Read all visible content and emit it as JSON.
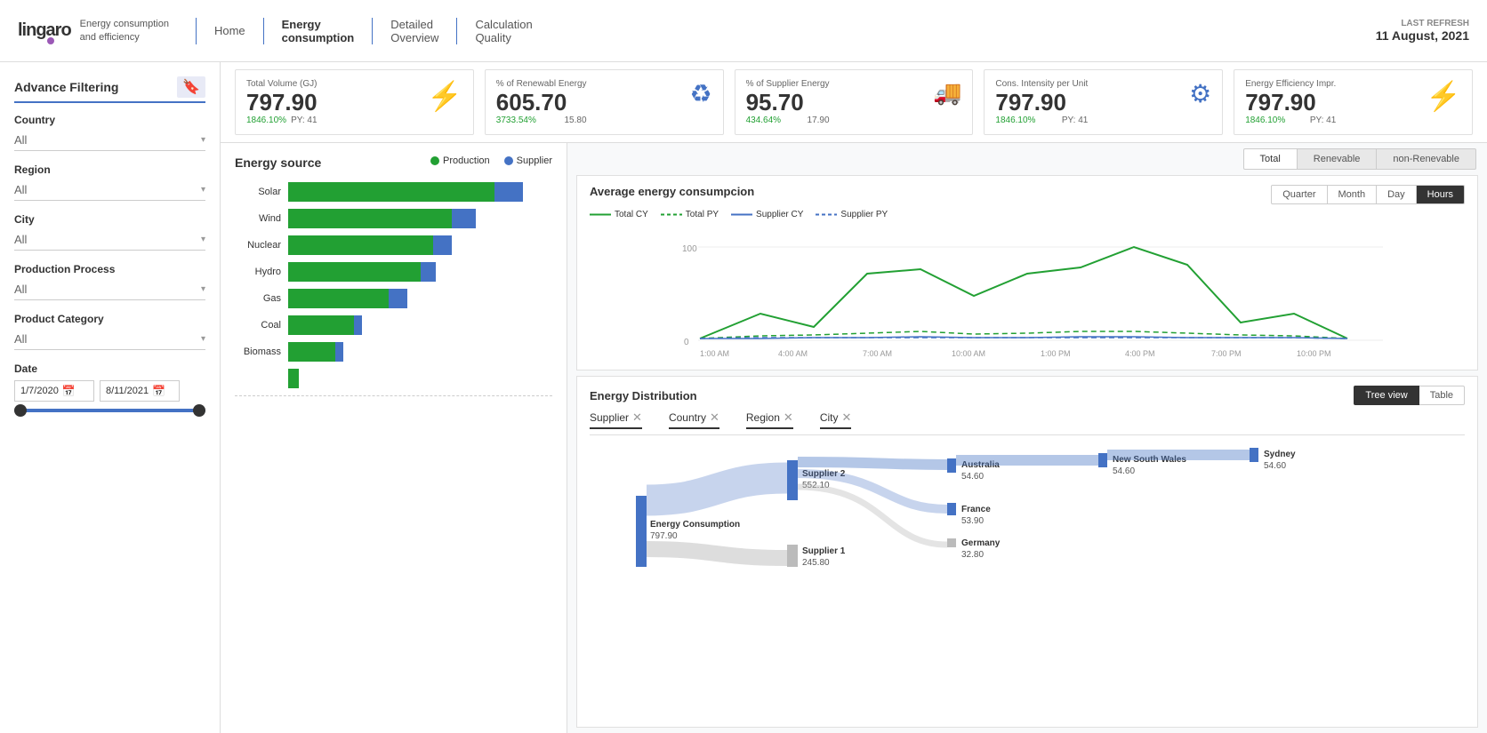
{
  "header": {
    "logo_text": "lingaro",
    "logo_subtitle": "Energy consumption\nand efficiency",
    "nav_items": [
      {
        "label": "Home",
        "active": false
      },
      {
        "label": "Energy\nconsumption",
        "active": true
      },
      {
        "label": "Detailed\nOverview",
        "active": false
      },
      {
        "label": "Calculation\nQuality",
        "active": false
      }
    ],
    "last_refresh_label": "LAST REFRESH",
    "last_refresh_date": "11 August, 2021"
  },
  "kpi_cards": [
    {
      "label": "Total Volume (GJ)",
      "value": "797.90",
      "percent": "1846.10%",
      "py": "PY: 41",
      "icon": "⚡"
    },
    {
      "label": "% of Renewabl Energy",
      "value": "605.70",
      "percent": "3733.54%",
      "py": "15.80",
      "icon": "♻"
    },
    {
      "label": "% of Supplier Energy",
      "value": "95.70",
      "percent": "434.64%",
      "py": "17.90",
      "icon": "🚚"
    },
    {
      "label": "Cons. Intensity per Unit",
      "value": "797.90",
      "percent": "1846.10%",
      "py": "PY: 41",
      "icon": "⚙"
    },
    {
      "label": "Energy Efficiency Impr.",
      "value": "797.90",
      "percent": "1846.10%",
      "py": "PY: 41",
      "icon": "⚡"
    }
  ],
  "sidebar": {
    "title": "Advance Filtering",
    "filters": [
      {
        "label": "Country",
        "value": "All"
      },
      {
        "label": "Region",
        "value": "All"
      },
      {
        "label": "City",
        "value": "All"
      },
      {
        "label": "Production Process",
        "value": "All"
      },
      {
        "label": "Product Category",
        "value": "All"
      }
    ],
    "date": {
      "label": "Date",
      "from": "1/7/2020",
      "to": "8/11/2021"
    }
  },
  "energy_source": {
    "title": "Energy source",
    "legend_production": "Production",
    "legend_supplier": "Supplier",
    "bars": [
      {
        "label": "Solar",
        "green": 85,
        "blue": 12
      },
      {
        "label": "Wind",
        "green": 68,
        "blue": 10
      },
      {
        "label": "Nuclear",
        "green": 60,
        "blue": 8
      },
      {
        "label": "Hydro",
        "green": 55,
        "blue": 7
      },
      {
        "label": "Gas",
        "green": 42,
        "blue": 8
      },
      {
        "label": "Coal",
        "green": 28,
        "blue": 3
      },
      {
        "label": "Biomass",
        "green": 20,
        "blue": 4
      },
      {
        "label": "",
        "green": 5,
        "blue": 0
      }
    ]
  },
  "avg_energy": {
    "title": "Average energy consumpcion",
    "top_toggles": [
      "Total",
      "Renevable",
      "non-Renevable"
    ],
    "active_top_toggle": "Total",
    "time_buttons": [
      "Quarter",
      "Month",
      "Day",
      "Hours"
    ],
    "active_time": "Hours",
    "legend": [
      {
        "label": "Total CY",
        "style": "solid-green"
      },
      {
        "label": "Total PY",
        "style": "dashed-green"
      },
      {
        "label": "Supplier CY",
        "style": "solid-blue"
      },
      {
        "label": "Supplier PY",
        "style": "dashed-blue"
      }
    ],
    "y_label": "100",
    "y_zero": "0",
    "x_labels": [
      "1:00 AM",
      "4:00 AM",
      "7:00 AM",
      "10:00 AM",
      "1:00 PM",
      "4:00 PM",
      "7:00 PM",
      "10:00 PM"
    ]
  },
  "energy_dist": {
    "title": "Energy Distribution",
    "view_buttons": [
      "Tree view",
      "Table"
    ],
    "active_view": "Tree view",
    "filters": [
      "Supplier",
      "Country",
      "Region",
      "City"
    ],
    "sankey": {
      "energy_label": "Energy Consumption",
      "energy_value": "797.90",
      "supplier2_label": "Supplier 2",
      "supplier2_value": "552.10",
      "supplier1_label": "Supplier 1",
      "supplier1_value": "245.80",
      "australia_label": "Australia",
      "australia_value": "54.60",
      "france_label": "France",
      "france_value": "53.90",
      "germany_label": "Germany",
      "germany_value": "32.80",
      "nsw_label": "New South Wales",
      "nsw_value": "54.60",
      "sydney_label": "Sydney",
      "sydney_value": "54.60"
    }
  }
}
